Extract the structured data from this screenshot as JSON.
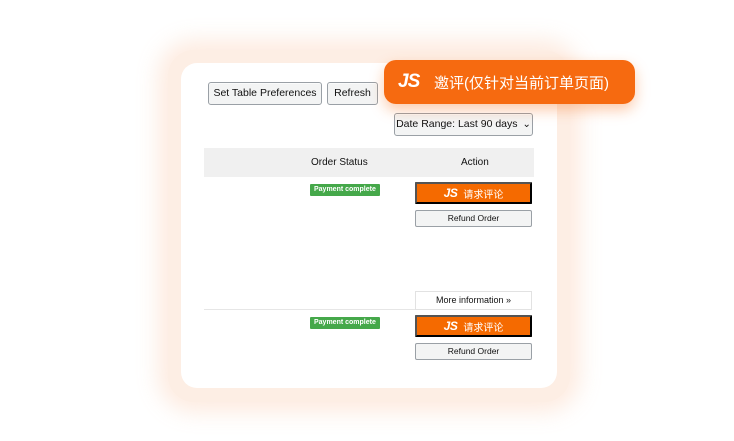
{
  "toolbar": {
    "set_table_preferences": "Set Table Preferences",
    "refresh": "Refresh",
    "date_range": "Date Range: Last 90 days"
  },
  "table": {
    "columns": [
      "Order Status",
      "Action"
    ]
  },
  "orders": [
    {
      "status": "Payment complete",
      "request_review": "请求评论",
      "refund": "Refund Order"
    },
    {
      "status": "Payment complete",
      "request_review": "请求评论",
      "refund": "Refund Order"
    }
  ],
  "more_information": "More information",
  "tooltip": {
    "logo": "JS",
    "text": "邀评(仅针对当前订单页面)"
  },
  "brand": {
    "mini_logo": "JS"
  },
  "colors": {
    "accent": "#f56a00",
    "badge_green": "#45a84a",
    "halo": "#fdeee4"
  },
  "icons": {
    "date_range_caret": "chevron-down-icon",
    "more_info_caret": "chevron-double-down-icon"
  }
}
